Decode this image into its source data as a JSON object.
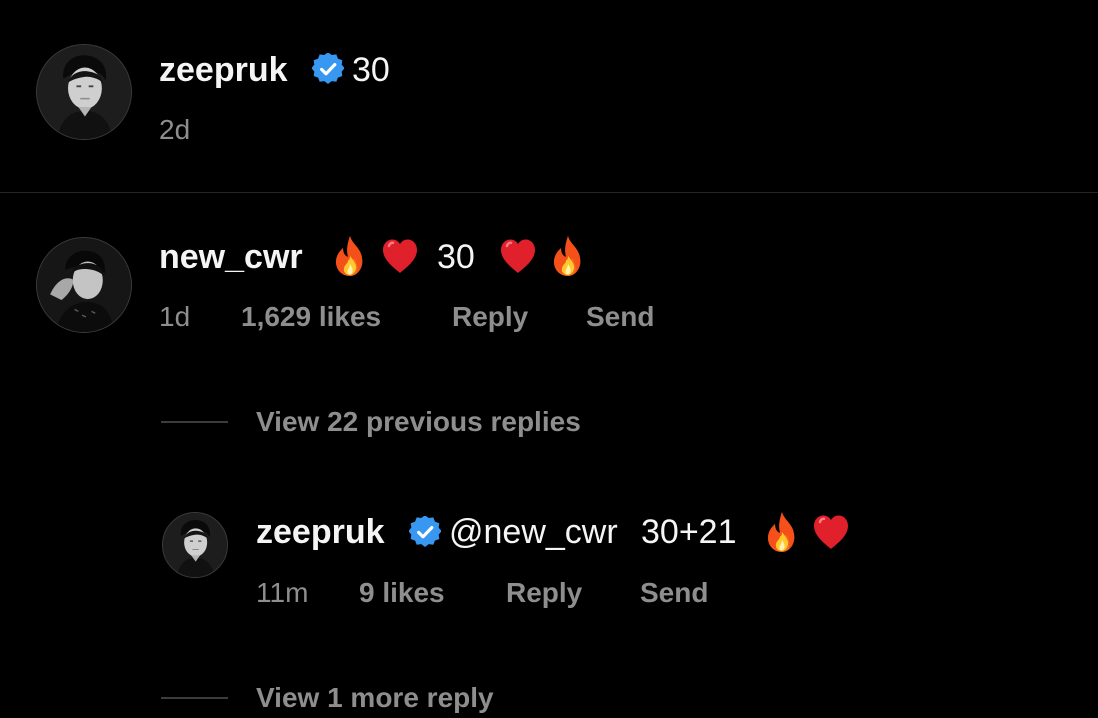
{
  "post": {
    "username": "zeepruk",
    "caption": "30",
    "time": "2d"
  },
  "comment": {
    "username": "new_cwr",
    "text": "30",
    "time": "1d",
    "likes": "1,629 likes",
    "reply_label": "Reply",
    "send_label": "Send",
    "view_previous": "View 22 previous replies"
  },
  "reply": {
    "username": "zeepruk",
    "mention": "@new_cwr",
    "text": "30+21",
    "time": "11m",
    "likes": "9 likes",
    "reply_label": "Reply",
    "send_label": "Send",
    "view_more": "View 1 more reply"
  },
  "colors": {
    "background": "#000000",
    "primary_text": "#f5f5f5",
    "secondary_text": "#8e8e8e",
    "verified_badge": "#3897f0",
    "divider": "#262626"
  },
  "icons": [
    "verified-badge-icon",
    "fire-emoji-icon",
    "red-heart-emoji-icon"
  ]
}
